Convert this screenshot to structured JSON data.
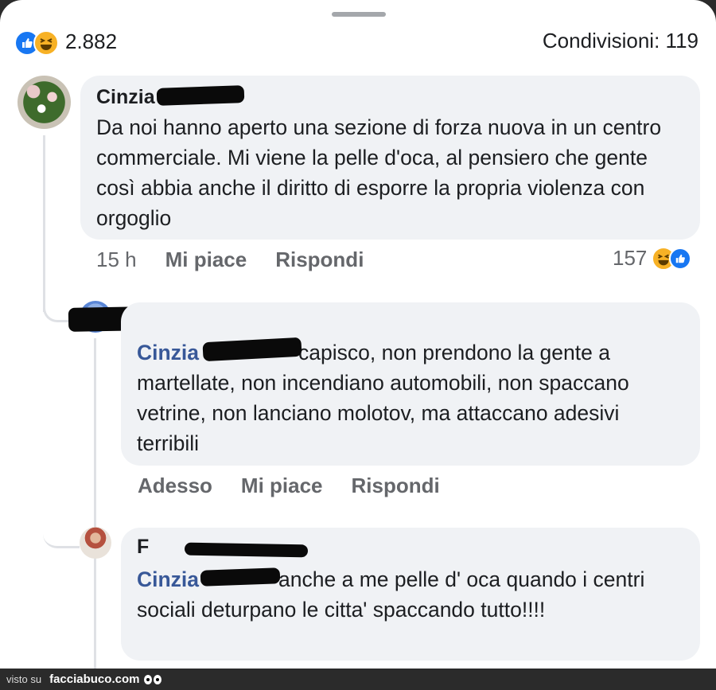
{
  "summary": {
    "reaction_count": "2.882",
    "shares": "Condivisioni: 119"
  },
  "comments": [
    {
      "author": "Cinzia",
      "text": "Da noi hanno aperto una sezione di forza nuova in un centro commerciale. Mi viene la pelle d'oca, al pensiero che gente così abbia anche il diritto di esporre la propria violenza con orgoglio",
      "time": "15 h",
      "like": "Mi piace",
      "reply": "Rispondi",
      "reactions": "157"
    },
    {
      "author": "",
      "mention": "Cinzia",
      "text": "capisco, non prendono la gente a martellate, non incendiano automobili, non spaccano vetrine, non lanciano molotov, ma attaccano adesivi terribili",
      "time": "Adesso",
      "like": "Mi piace",
      "reply": "Rispondi"
    },
    {
      "author": "F",
      "mention": "Cinzia",
      "text": "anche a me pelle d' oca quando i centri sociali  deturpano le citta'  spaccando tutto!!!!"
    }
  ],
  "footer": {
    "visto": "visto su",
    "site": "facciabuco.com"
  },
  "colors": {
    "bubble": "#f0f2f5",
    "mention": "#385898",
    "like_blue": "#1877f2",
    "haha_yellow": "#f7b125"
  }
}
